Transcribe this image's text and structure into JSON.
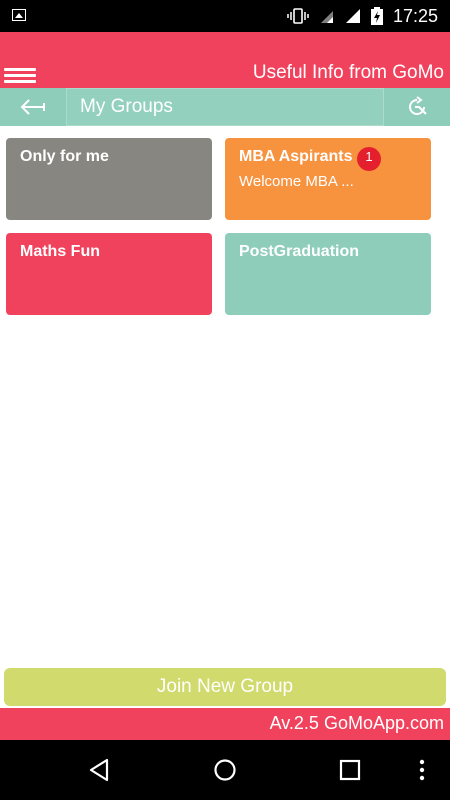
{
  "status_bar": {
    "time": "17:25"
  },
  "app_bar": {
    "title": "Useful Info from GoMo"
  },
  "nav": {
    "title": "My Groups"
  },
  "groups": [
    {
      "name": "Only for me",
      "message": "",
      "color": "#878681"
    },
    {
      "name": "MBA Aspirants",
      "message": "Welcome MBA ...",
      "badge": "1",
      "color": "#f7923f"
    },
    {
      "name": "Maths Fun",
      "message": "",
      "color": "#f1425d"
    },
    {
      "name": "PostGraduation",
      "message": "",
      "color": "#8ecdb9"
    }
  ],
  "join_button": {
    "label": "Join New Group",
    "color": "#d0da6d"
  },
  "footer": {
    "text": "Av.2.5 GoMoApp.com"
  },
  "colors": {
    "primary": "#f1425d",
    "secondary": "#8ecdb9"
  }
}
